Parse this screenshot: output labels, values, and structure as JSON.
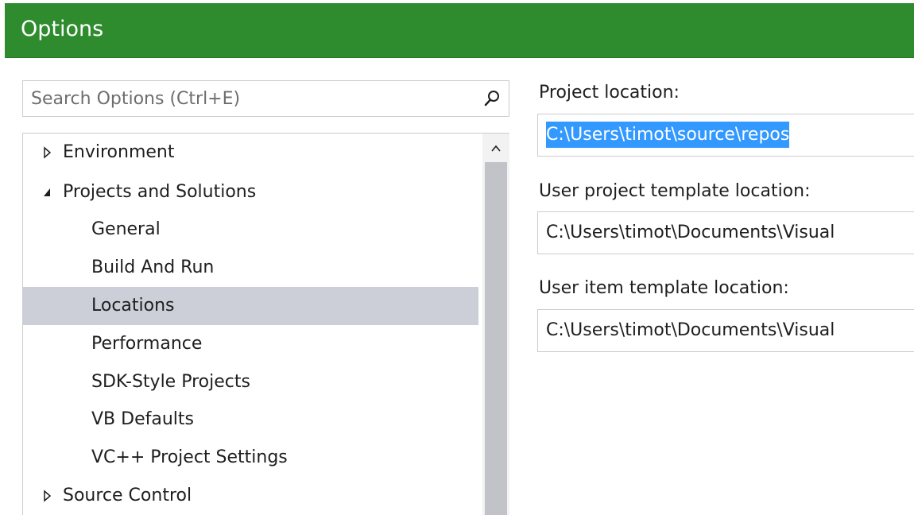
{
  "window": {
    "title": "Options",
    "accent": "#2e8b2e"
  },
  "search": {
    "placeholder": "Search Options (Ctrl+E)",
    "icon": "search-icon"
  },
  "tree": {
    "items": [
      {
        "label": "Environment",
        "level": 0,
        "state": "collapsed"
      },
      {
        "label": "Projects and Solutions",
        "level": 0,
        "state": "expanded"
      },
      {
        "label": "General",
        "level": 1
      },
      {
        "label": "Build And Run",
        "level": 1
      },
      {
        "label": "Locations",
        "level": 1,
        "selected": true
      },
      {
        "label": "Performance",
        "level": 1
      },
      {
        "label": "SDK-Style Projects",
        "level": 1
      },
      {
        "label": "VB Defaults",
        "level": 1
      },
      {
        "label": "VC++ Project Settings",
        "level": 1
      },
      {
        "label": "Source Control",
        "level": 0,
        "state": "collapsed"
      }
    ],
    "selected_color": "#ccced8"
  },
  "fields": {
    "project_location": {
      "label": "Project location:",
      "value": "C:\\Users\\timot\\source\\repos"
    },
    "user_project_template": {
      "label": "User project template location:",
      "value": "C:\\Users\\timot\\Documents\\Visual"
    },
    "user_item_template": {
      "label": "User item template location:",
      "value": "C:\\Users\\timot\\Documents\\Visual"
    }
  }
}
